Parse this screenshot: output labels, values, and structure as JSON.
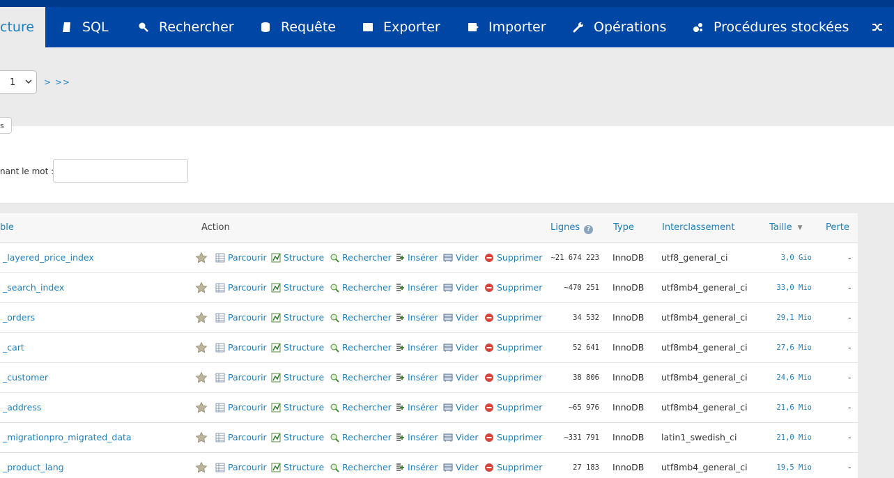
{
  "tabs": [
    {
      "label": "cture",
      "icon": "structure-icon",
      "active": true
    },
    {
      "label": "SQL",
      "icon": "sql-icon"
    },
    {
      "label": "Rechercher",
      "icon": "search-icon"
    },
    {
      "label": "Requête",
      "icon": "query-icon"
    },
    {
      "label": "Exporter",
      "icon": "export-icon"
    },
    {
      "label": "Importer",
      "icon": "import-icon"
    },
    {
      "label": "Opérations",
      "icon": "wrench-icon"
    },
    {
      "label": "Procédures stockées",
      "icon": "routines-icon"
    }
  ],
  "pager": {
    "page_value": "1",
    "next_label": "> >>"
  },
  "filter": {
    "legend": "s",
    "label": "nant le mot :",
    "value": ""
  },
  "columns": {
    "table": "ble",
    "action": "Action",
    "rows": "Lignes",
    "type": "Type",
    "collation": "Interclassement",
    "size": "Taille",
    "overhead": "Perte"
  },
  "actions": {
    "browse": "Parcourir",
    "structure": "Structure",
    "search": "Rechercher",
    "insert": "Insérer",
    "empty": "Vider",
    "drop": "Supprimer"
  },
  "rows": [
    {
      "name": "_layered_price_index",
      "rows": "~21 674 223",
      "type": "InnoDB",
      "collation": "utf8_general_ci",
      "size": "3,0 Gio",
      "overhead": "-"
    },
    {
      "name": "_search_index",
      "rows": "~470 251",
      "type": "InnoDB",
      "collation": "utf8mb4_general_ci",
      "size": "33,0 Mio",
      "overhead": "-"
    },
    {
      "name": "_orders",
      "rows": "34 532",
      "type": "InnoDB",
      "collation": "utf8mb4_general_ci",
      "size": "29,1 Mio",
      "overhead": "-"
    },
    {
      "name": "_cart",
      "rows": "52 641",
      "type": "InnoDB",
      "collation": "utf8mb4_general_ci",
      "size": "27,6 Mio",
      "overhead": "-"
    },
    {
      "name": "_customer",
      "rows": "38 806",
      "type": "InnoDB",
      "collation": "utf8mb4_general_ci",
      "size": "24,6 Mio",
      "overhead": "-"
    },
    {
      "name": "_address",
      "rows": "~65 976",
      "type": "InnoDB",
      "collation": "utf8mb4_general_ci",
      "size": "21,6 Mio",
      "overhead": "-"
    },
    {
      "name": "_migrationpro_migrated_data",
      "rows": "~331 791",
      "type": "InnoDB",
      "collation": "latin1_swedish_ci",
      "size": "21,0 Mio",
      "overhead": "-"
    },
    {
      "name": "_product_lang",
      "rows": "27 183",
      "type": "InnoDB",
      "collation": "utf8mb4_general_ci",
      "size": "19,5 Mio",
      "overhead": "-"
    }
  ]
}
